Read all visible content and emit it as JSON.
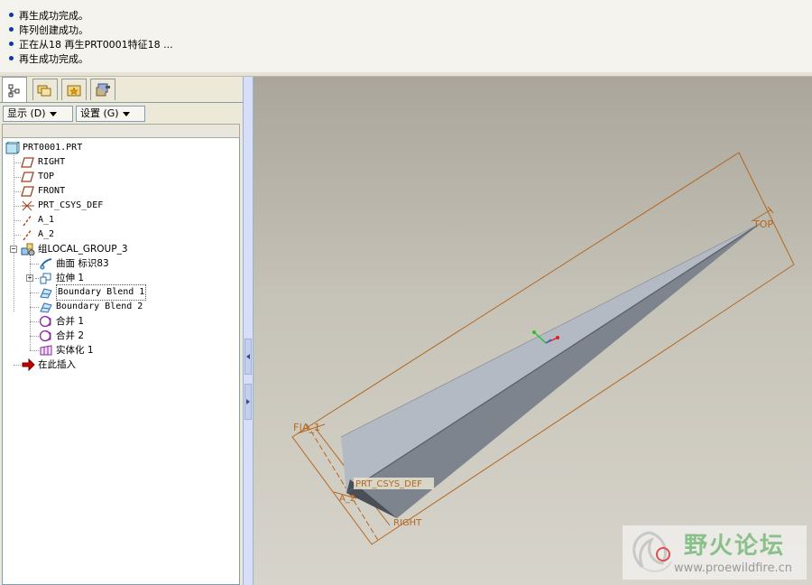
{
  "messages": [
    "再生成功完成。",
    "阵列创建成功。",
    "正在从18 再生PRT0001特征18 ...",
    "再生成功完成。"
  ],
  "panel": {
    "tabs": [
      "model-tree-icon",
      "folder-browser-icon",
      "favorites-icon",
      "connections-icon"
    ],
    "show_label": "显示 (D)",
    "settings_label": "设置 (G)"
  },
  "tree": {
    "root": "PRT0001.PRT",
    "items": [
      {
        "label": "RIGHT",
        "icon": "datum-plane-icon"
      },
      {
        "label": "TOP",
        "icon": "datum-plane-icon"
      },
      {
        "label": "FRONT",
        "icon": "datum-plane-icon"
      },
      {
        "label": "PRT_CSYS_DEF",
        "icon": "coordinate-system-icon"
      },
      {
        "label": "A_1",
        "icon": "datum-axis-icon"
      },
      {
        "label": "A_2",
        "icon": "datum-axis-icon"
      },
      {
        "label": "组LOCAL_GROUP_3",
        "icon": "group-icon"
      },
      {
        "label": "曲面 标识83",
        "icon": "surface-icon"
      },
      {
        "label": "拉伸 1",
        "icon": "extrude-icon"
      },
      {
        "label": "Boundary Blend 1",
        "icon": "boundary-blend-icon"
      },
      {
        "label": "Boundary Blend 2",
        "icon": "boundary-blend-icon"
      },
      {
        "label": "合并 1",
        "icon": "merge-icon"
      },
      {
        "label": "合并 2",
        "icon": "merge-icon"
      },
      {
        "label": "实体化 1",
        "icon": "solidify-icon"
      },
      {
        "label": "在此插入",
        "icon": "insert-here-arrow-icon"
      }
    ]
  },
  "viewport": {
    "datum_labels": {
      "top": "TOP",
      "front_a1": "F|A_1",
      "csys": "PRT_CSYS_DEF",
      "a2": "A_2",
      "right": "RIGHT"
    }
  },
  "watermark": {
    "title": "野火论坛",
    "url": "www.proewildfire.cn"
  },
  "colors": {
    "datum": "#b5671e",
    "part_light": "#b3bac4",
    "part_dark": "#7d848d",
    "background_top": "#aaa69b",
    "background_bottom": "#d7d4cb"
  }
}
